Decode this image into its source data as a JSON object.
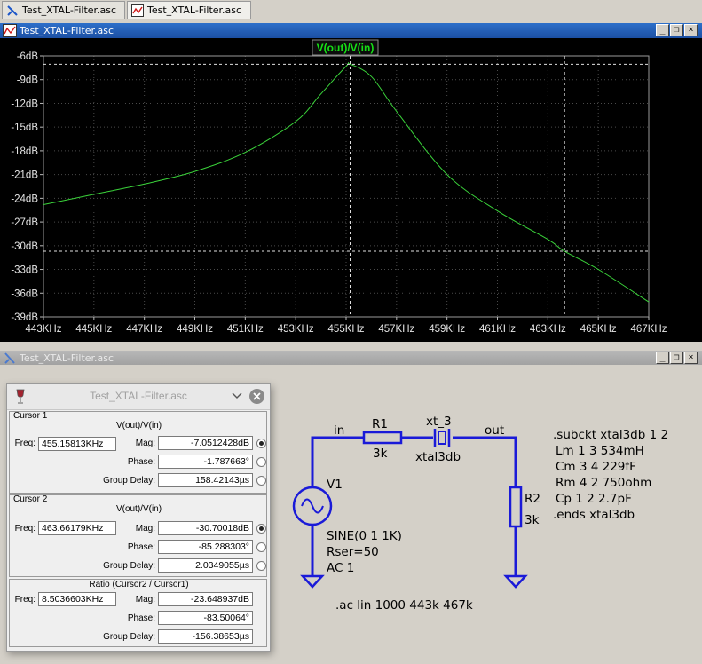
{
  "tabs": [
    {
      "label": "Test_XTAL-Filter.asc",
      "icon": "schematic-icon"
    },
    {
      "label": "Test_XTAL-Filter.asc",
      "icon": "waveform-icon"
    }
  ],
  "plot_window": {
    "title": "Test_XTAL-Filter.asc",
    "trace_label": "V(out)/V(in)",
    "y_ticks": [
      "-6dB",
      "-9dB",
      "-12dB",
      "-15dB",
      "-18dB",
      "-21dB",
      "-24dB",
      "-27dB",
      "-30dB",
      "-33dB",
      "-36dB",
      "-39dB"
    ],
    "x_ticks": [
      "443KHz",
      "445KHz",
      "447KHz",
      "449KHz",
      "451KHz",
      "453KHz",
      "455KHz",
      "457KHz",
      "459KHz",
      "461KHz",
      "463KHz",
      "465KHz",
      "467KHz"
    ],
    "colors": {
      "background": "#000000",
      "trace": "#3ad23a",
      "grid": "#c8c8c8"
    }
  },
  "schematic_window": {
    "title": "Test_XTAL-Filter.asc",
    "labels": {
      "net_in": "in",
      "net_out": "out",
      "r1_name": "R1",
      "r1_value": "3k",
      "xt_name": "xt_3",
      "xt_value": "xtal3db",
      "r2_name": "R2",
      "r2_value": "3k",
      "v1_name": "V1",
      "v1_line1": "SINE(0 1 1K)",
      "v1_line2": "Rser=50",
      "v1_line3": "AC 1",
      "directive": ".ac lin 1000 443k 467k"
    },
    "subckt": [
      ".subckt xtal3db 1 2",
      "Lm 1 3 534mH",
      "Cm 3 4 229fF",
      "Rm 4 2 750ohm",
      "Cp 1 2 2.7pF",
      ".ends  xtal3db"
    ],
    "colors": {
      "wire": "#1a1ad8"
    }
  },
  "cursor_dialog": {
    "title": "Test_XTAL-Filter.asc",
    "cursor1": {
      "label": "Cursor 1",
      "trace": "V(out)/V(in)",
      "freq_label": "Freq:",
      "freq": "455.15813KHz",
      "mag_label": "Mag:",
      "mag": "-7.0512428dB",
      "phase_label": "Phase:",
      "phase": "-1.787663°",
      "gd_label": "Group Delay:",
      "gd": "158.42143µs"
    },
    "cursor2": {
      "label": "Cursor 2",
      "trace": "V(out)/V(in)",
      "freq_label": "Freq:",
      "freq": "463.66179KHz",
      "mag_label": "Mag:",
      "mag": "-30.70018dB",
      "phase_label": "Phase:",
      "phase": "-85.288303°",
      "gd_label": "Group Delay:",
      "gd": "2.0349055µs"
    },
    "ratio": {
      "label": "Ratio (Cursor2 / Cursor1)",
      "freq_label": "Freq:",
      "freq": "8.5036603KHz",
      "mag_label": "Mag:",
      "mag": "-23.648937dB",
      "phase_label": "Phase:",
      "phase": "-83.50064°",
      "gd_label": "Group Delay:",
      "gd": "-156.38653µs"
    }
  },
  "chart_data": {
    "type": "line",
    "series": [
      {
        "name": "V(out)/V(in)",
        "x": [
          443,
          445,
          447,
          449,
          451,
          453,
          454,
          455,
          455.16,
          456,
          457,
          459,
          461,
          463,
          463.66,
          465,
          467
        ],
        "values": [
          -24.8,
          -23.5,
          -22.2,
          -20.6,
          -18.2,
          -14.3,
          -10.8,
          -7.3,
          -7.05,
          -8.6,
          -13.0,
          -21.0,
          -25.6,
          -29.2,
          -30.7,
          -33.0,
          -37.1
        ]
      }
    ],
    "xlim": [
      443,
      467
    ],
    "ylim": [
      -39,
      -6
    ],
    "x_unit": "KHz",
    "y_unit": "dB",
    "cursors": [
      {
        "x": 455.15813,
        "y": -7.0512428
      },
      {
        "x": 463.66179,
        "y": -30.70018
      }
    ],
    "grid": true
  }
}
